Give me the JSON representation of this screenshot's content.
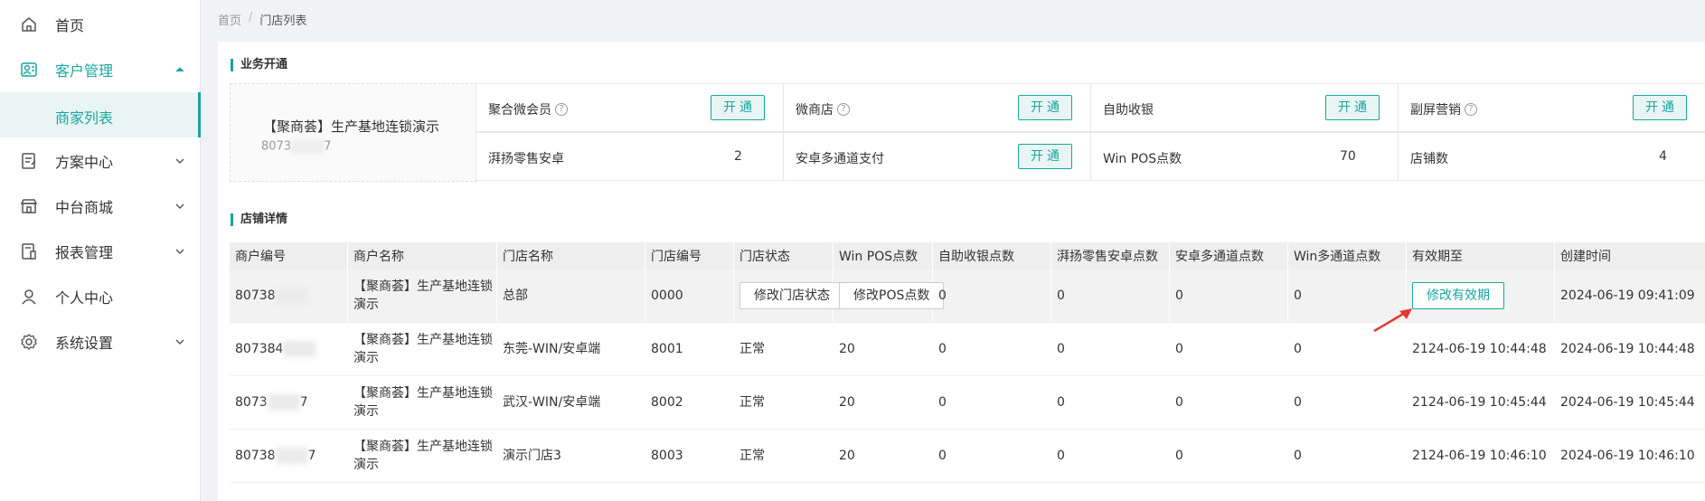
{
  "sidebar": {
    "items": [
      {
        "label": "首页",
        "icon": "home-icon"
      },
      {
        "label": "客户管理",
        "icon": "customer-icon"
      },
      {
        "label": "商家列表"
      },
      {
        "label": "方案中心",
        "icon": "plan-icon"
      },
      {
        "label": "中台商城",
        "icon": "store-icon"
      },
      {
        "label": "报表管理",
        "icon": "report-icon"
      },
      {
        "label": "个人中心",
        "icon": "user-icon"
      },
      {
        "label": "系统设置",
        "icon": "gear-icon"
      }
    ]
  },
  "breadcrumb": {
    "home": "首页",
    "sep": "/",
    "current": "门店列表"
  },
  "business": {
    "title": "业务开通",
    "store_name": "【聚商荟】生产基地连锁演示",
    "store_id_prefix": "8073",
    "store_id_suffix": "7",
    "open_label": "开通",
    "row1": [
      {
        "label": "聚合微会员",
        "help": true
      },
      {
        "label": "微商店",
        "help": true
      },
      {
        "label": "自助收银",
        "help": false
      },
      {
        "label": "副屏营销",
        "help": true
      }
    ],
    "row2": [
      {
        "label": "湃扬零售安卓",
        "value": "2"
      },
      {
        "label": "安卓多通道支付",
        "button": true
      },
      {
        "label": "Win POS点数",
        "value": "70"
      },
      {
        "label": "店铺数",
        "value": "4"
      }
    ]
  },
  "details": {
    "title": "店铺详情",
    "headers": [
      "商户编号",
      "商户名称",
      "门店名称",
      "门店编号",
      "门店状态",
      "Win POS点数",
      "自助收银点数",
      "湃扬零售安卓点数",
      "安卓多通道点数",
      "Win多通道点数",
      "有效期至",
      "创建时间"
    ],
    "rows": [
      {
        "merchant_id": "80738",
        "merchant_name": "【聚商荟】生产基地连锁演示",
        "store_name": "总部",
        "store_no": "0000",
        "status_btn": "修改门店状态",
        "pos_btn": "修改POS点数",
        "self": "0",
        "android": "0",
        "multi": "0",
        "win_multi": "0",
        "expiry_btn": "修改有效期",
        "created": "2024-06-19 09:41:09"
      },
      {
        "merchant_id": "807384",
        "merchant_name": "【聚商荟】生产基地连锁演示",
        "store_name": "东莞-WIN/安卓端",
        "store_no": "8001",
        "status": "正常",
        "pos": "20",
        "self": "0",
        "android": "0",
        "multi": "0",
        "win_multi": "0",
        "expiry": "2124-06-19 10:44:48",
        "created": "2024-06-19 10:44:48"
      },
      {
        "merchant_id": "8073",
        "merchant_suffix": "7",
        "merchant_name": "【聚商荟】生产基地连锁演示",
        "store_name": "武汉-WIN/安卓端",
        "store_no": "8002",
        "status": "正常",
        "pos": "20",
        "self": "0",
        "android": "0",
        "multi": "0",
        "win_multi": "0",
        "expiry": "2124-06-19 10:45:44",
        "created": "2024-06-19 10:45:44"
      },
      {
        "merchant_id": "80738",
        "merchant_suffix": "7",
        "merchant_name": "【聚商荟】生产基地连锁演示",
        "store_name": "演示门店3",
        "store_no": "8003",
        "status": "正常",
        "pos": "20",
        "self": "0",
        "android": "0",
        "multi": "0",
        "win_multi": "0",
        "expiry": "2124-06-19 10:46:10",
        "created": "2024-06-19 10:46:10"
      }
    ]
  },
  "colors": {
    "accent": "#1aa59e",
    "annotation": "#e53935"
  }
}
